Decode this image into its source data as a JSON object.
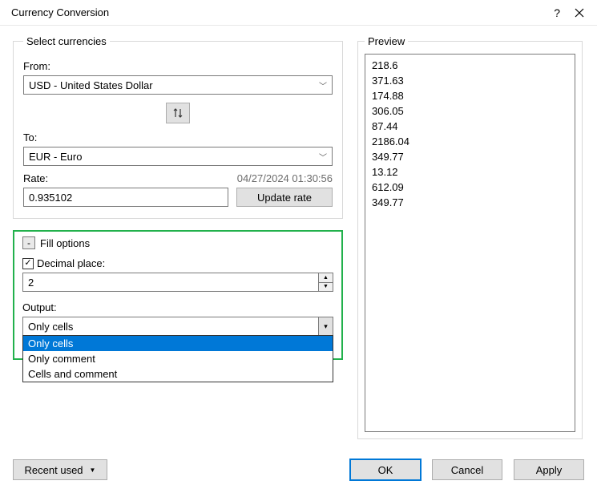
{
  "window": {
    "title": "Currency Conversion"
  },
  "select_currencies": {
    "legend": "Select currencies",
    "from_label": "From:",
    "from_value": "USD - United States Dollar",
    "to_label": "To:",
    "to_value": "EUR - Euro",
    "rate_label": "Rate:",
    "rate_timestamp": "04/27/2024 01:30:56",
    "rate_value": "0.935102",
    "update_rate_label": "Update rate"
  },
  "fill_options": {
    "legend": "Fill options",
    "decimal_place_label": "Decimal place:",
    "decimal_place_value": "2",
    "output_label": "Output:",
    "output_selected": "Only cells",
    "output_options": [
      "Only cells",
      "Only comment",
      "Cells and comment"
    ]
  },
  "preview": {
    "legend": "Preview",
    "values": [
      "218.6",
      "371.63",
      "174.88",
      "306.05",
      "87.44",
      "2186.04",
      "349.77",
      "13.12",
      "612.09",
      "349.77"
    ]
  },
  "footer": {
    "recent_label": "Recent used",
    "ok": "OK",
    "cancel": "Cancel",
    "apply": "Apply"
  }
}
